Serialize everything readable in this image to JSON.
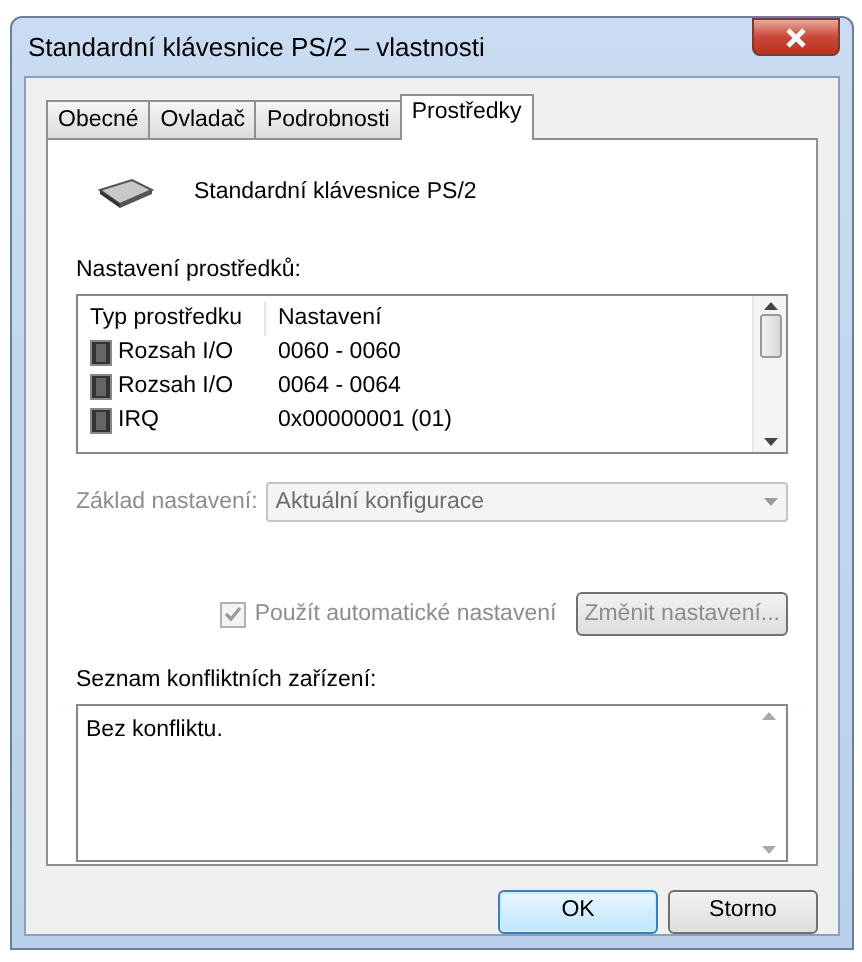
{
  "window": {
    "title": "Standardní klávesnice PS/2 – vlastnosti"
  },
  "tabs": [
    {
      "label": "Obecné",
      "selected": false
    },
    {
      "label": "Ovladač",
      "selected": false
    },
    {
      "label": "Podrobnosti",
      "selected": false
    },
    {
      "label": "Prostředky",
      "selected": true
    }
  ],
  "device_name": "Standardní klávesnice PS/2",
  "resources": {
    "label": "Nastavení prostředků:",
    "columns": [
      "Typ prostředku",
      "Nastavení"
    ],
    "rows": [
      {
        "type": "Rozsah I/O",
        "setting": "0060 - 0060"
      },
      {
        "type": "Rozsah I/O",
        "setting": "0064 - 0064"
      },
      {
        "type": "IRQ",
        "setting": "0x00000001 (01)"
      }
    ]
  },
  "base_setting": {
    "label": "Základ nastavení:",
    "value": "Aktuální konfigurace",
    "disabled": true
  },
  "auto_setting": {
    "label": "Použít automatické nastavení",
    "checked": true,
    "disabled": true
  },
  "change_button": {
    "label": "Změnit nastavení..."
  },
  "conflicts": {
    "label": "Seznam konfliktních zařízení:",
    "text": "Bez konfliktu."
  },
  "buttons": [
    {
      "label": "OK",
      "default": true
    },
    {
      "label": "Storno",
      "default": false
    }
  ]
}
